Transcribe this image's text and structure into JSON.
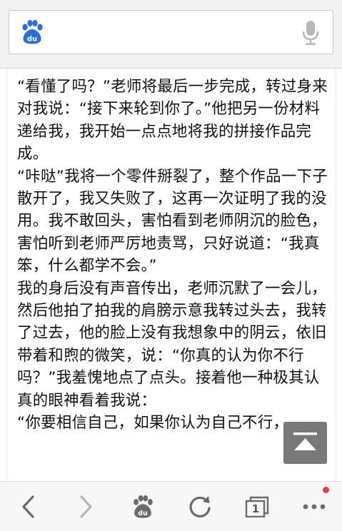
{
  "search": {
    "placeholder": "",
    "value": ""
  },
  "article": {
    "paragraphs": [
      "“看懂了吗？”老师将最后一步完成，转过身来对我说：“接下来轮到你了。”他把另一份材料递给我，我开始一点点地将我的拼接作品完成。",
      "“咔哒”我将一个零件掰裂了，整个作品一下子散开了，我又失败了，这再一次证明了我的没用。我不敢回头，害怕看到老师阴沉的脸色，害怕听到老师严厉地责骂，只好说道：“我真笨，什么都学不会。”",
      "我的身后没有声音传出，老师沉默了一会儿，然后他拍了拍我的肩膀示意我转过头去，我转了过去，他的脸上没有我想象中的阴云，依旧带着和煦的微笑，说：“你真的认为你不行吗？”我羞愧地点了点头。接着他一种极其认真的眼神看着我说：",
      "“你要相信自己，如果你认为自己不行，"
    ]
  },
  "toolbar": {
    "tab_count": "1",
    "icons": [
      "back-icon",
      "forward-icon",
      "baidu-home-icon",
      "refresh-icon",
      "tabs-icon",
      "more-icon"
    ]
  },
  "colors": {
    "baidu_blue": "#2b6fd6",
    "icon_gray": "#6b6b6b",
    "icon_disabled": "#b5b5b5",
    "notify_red": "#e5413b"
  }
}
